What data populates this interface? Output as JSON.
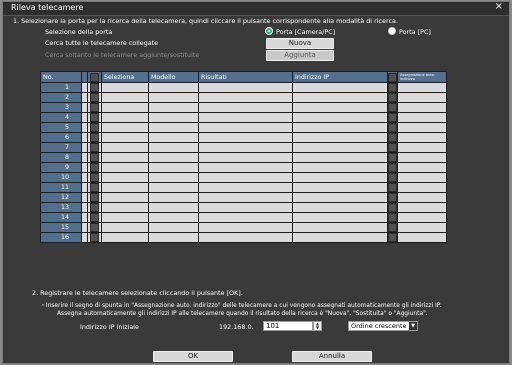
{
  "window": {
    "title": "Rileva telecamere",
    "close_label": "×"
  },
  "step1": {
    "instruction": "1. Selezionare la porta per la ricerca della telecamera, quindi cliccare il pulsante corrispondente alla modalità di ricerca.",
    "port_label": "Selezione della porta",
    "port_option_camera": "Porta [Camera/PC]",
    "port_option_pc": "Porta [PC]",
    "search_all_label": "Cerca tutte le telecamere collegate",
    "search_added_label": "Cerca soltanto le telecamere aggiunte/sostituite",
    "new_button": "Nuova",
    "added_button": "Aggiunta"
  },
  "table": {
    "headers": {
      "no": "No.",
      "select": "Seleziona",
      "model": "Modello",
      "results": "Risultati",
      "ip": "Indirizzo IP",
      "auto_ip": "Assegnazione auto. indirizzo"
    },
    "rows": [
      "1",
      "2",
      "3",
      "4",
      "5",
      "6",
      "7",
      "8",
      "9",
      "10",
      "11",
      "12",
      "13",
      "14",
      "15",
      "16"
    ]
  },
  "step2": {
    "instruction": "2. Registrare le telecamere selezionate cliccando il pulsante [OK].",
    "note": "・Inserire il segno di spunta in \"Assegnazione auto. indirizzo\" delle telecamere a cui vengono assegnati automaticamente gli indirizzi IP.",
    "auto_assign_text": "Assegna automaticamente gli indirizzi IP alle telecamere quando il risultato della ricerca è \"Nuova\", \"Sostituita\" o \"Aggiunta\".",
    "start_ip_label": "Indirizzo IP iniziale",
    "ip_prefix": "192.168.0.",
    "ip_value": "101",
    "order_value": "Ordine crescente"
  },
  "footer": {
    "ok_label": "OK",
    "cancel_label": "Annulla"
  },
  "colors": {
    "accent_radio": "#2fb37a",
    "table_header": "#53708f"
  }
}
